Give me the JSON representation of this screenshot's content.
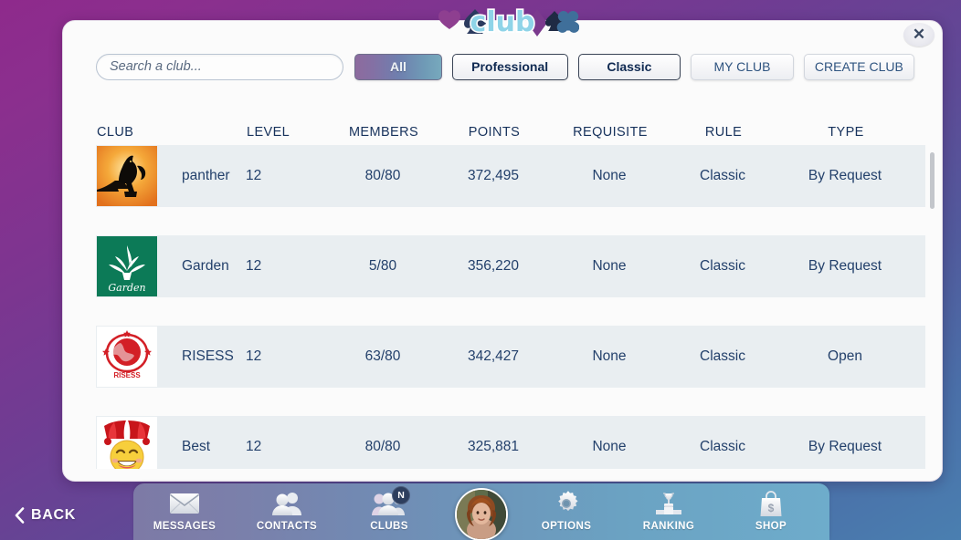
{
  "window": {
    "logo_text": "club",
    "close_label": "✕"
  },
  "toolbar": {
    "search": {
      "placeholder": "Search a club...",
      "value": ""
    },
    "filters": [
      {
        "id": "all",
        "label": "All",
        "state": "active"
      },
      {
        "id": "professional",
        "label": "Professional",
        "state": "normal"
      },
      {
        "id": "classic",
        "label": "Classic",
        "state": "normal"
      }
    ],
    "actions": [
      {
        "id": "my-club",
        "label": "MY CLUB"
      },
      {
        "id": "create-club",
        "label": "CREATE CLUB"
      }
    ]
  },
  "table": {
    "headers": {
      "club": "CLUB",
      "level": "LEVEL",
      "members": "MEMBERS",
      "points": "POINTS",
      "requisite": "REQUISITE",
      "rule": "RULE",
      "type": "TYPE"
    },
    "rows": [
      {
        "avatar": "panther-logo",
        "name": "panther",
        "level": "12",
        "members": "80/80",
        "points": "372,495",
        "requisite": "None",
        "rule": "Classic",
        "type": "By Request"
      },
      {
        "avatar": "garden-logo",
        "name": "Garden",
        "level": "12",
        "members": "5/80",
        "points": "356,220",
        "requisite": "None",
        "rule": "Classic",
        "type": "By Request"
      },
      {
        "avatar": "risess-logo",
        "name": "RISESS",
        "level": "12",
        "members": "63/80",
        "points": "342,427",
        "requisite": "None",
        "rule": "Classic",
        "type": "Open"
      },
      {
        "avatar": "jester-logo",
        "name": "Best",
        "level": "12",
        "members": "80/80",
        "points": "325,881",
        "requisite": "None",
        "rule": "Classic",
        "type": "By Request"
      }
    ]
  },
  "navbar": {
    "items": [
      {
        "id": "messages",
        "label": "MESSAGES",
        "icon": "envelope-icon",
        "badge": ""
      },
      {
        "id": "contacts",
        "label": "CONTACTS",
        "icon": "contacts-icon",
        "badge": ""
      },
      {
        "id": "clubs",
        "label": "CLUBS",
        "icon": "clubs-icon",
        "badge": "N"
      },
      {
        "id": "options",
        "label": "OPTIONS",
        "icon": "gear-icon",
        "badge": ""
      },
      {
        "id": "ranking",
        "label": "RANKING",
        "icon": "podium-icon",
        "badge": ""
      },
      {
        "id": "shop",
        "label": "SHOP",
        "icon": "shopping-bag-icon",
        "badge": ""
      }
    ]
  },
  "back": {
    "label": "BACK"
  },
  "colors": {
    "background_start": "#8e2a8c",
    "background_end": "#4a7fb0",
    "panel": "#fbfbfb",
    "row": "#e9eef1",
    "text_primary": "#23406b",
    "header_text": "#17325c",
    "accent_active_start": "#8d6b9e",
    "accent_active_end": "#77a9bd"
  }
}
